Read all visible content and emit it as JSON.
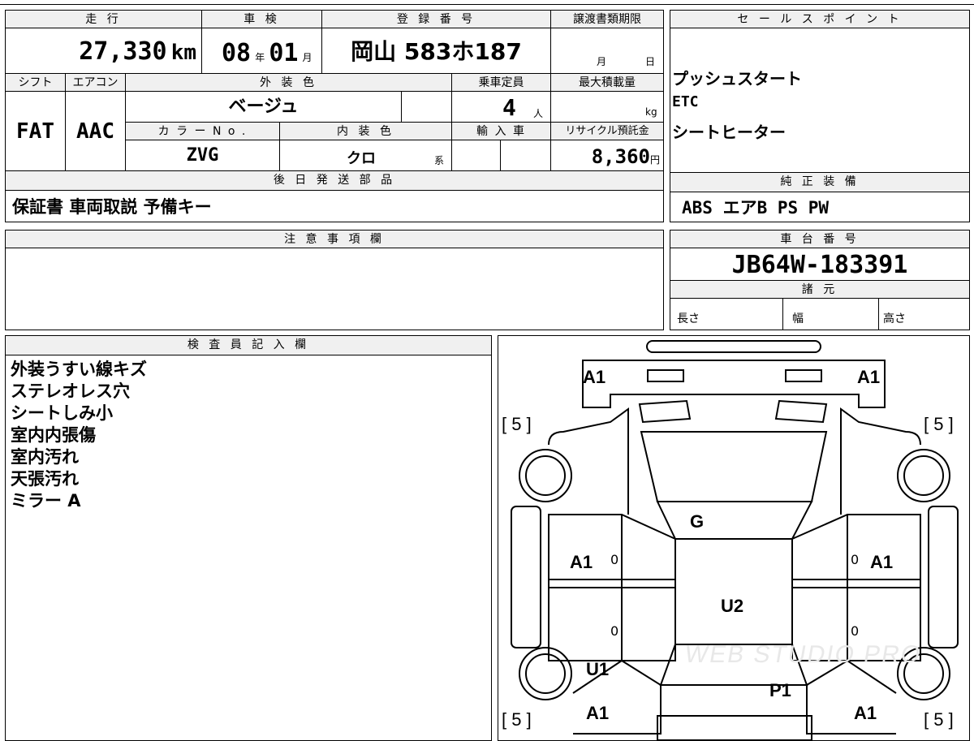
{
  "top_section": {
    "headers": {
      "mileage": "走 行",
      "inspection": "車 検",
      "registration": "登 録 番 号",
      "transfer_deadline": "譲渡書類期限",
      "shift": "シフト",
      "aircon": "エアコン",
      "exterior_color": "外 装 色",
      "capacity": "乗車定員",
      "max_load": "最大積載量",
      "color_no": "カ ラ ー N o .",
      "interior_color": "内 装 色",
      "import": "輸 入 車",
      "recycle_fee": "リサイクル預託金",
      "later_parts": "後 日 発 送 部 品"
    },
    "mileage_value": "27,330",
    "mileage_unit": "km",
    "inspection_year": "08",
    "inspection_year_unit": "年",
    "inspection_month": "01",
    "inspection_month_unit": "月",
    "registration_number": "岡山 583ホ187",
    "transfer_month_unit": "月",
    "transfer_day_unit": "日",
    "shift_value": "FAT",
    "aircon_value": "AAC",
    "exterior_color_value": "ベージュ",
    "capacity_value": "4",
    "capacity_unit": "人",
    "max_load_unit": "kg",
    "color_no_value": "ZVG",
    "interior_color_value": "クロ",
    "interior_color_suffix": "系",
    "recycle_fee_value": "8,360",
    "recycle_fee_unit": "円",
    "later_parts_value": "保証書 車両取説 予備キー"
  },
  "sales_points": {
    "header": "セ ー ル ス ポ イ ン ト",
    "items": [
      "プッシュスタート",
      "ETC",
      "シートヒーター"
    ]
  },
  "standard_equipment": {
    "header": "純 正 装 備",
    "value": "ABS エアB PS PW"
  },
  "notes": {
    "header": "注 意 事 項 欄"
  },
  "chassis": {
    "header": "車 台 番 号",
    "value": "JB64W-183391"
  },
  "specs": {
    "header": "諸 元",
    "length": "長さ",
    "width": "幅",
    "height": "高さ"
  },
  "inspector": {
    "header": "検 査 員 記 入 欄",
    "lines": [
      "外装うすい線キズ",
      "ステレオレス穴",
      "シートしみ小",
      "室内内張傷",
      "室内汚れ",
      "天張汚れ",
      "ミラー A"
    ]
  },
  "diagram": {
    "labels": {
      "front_left": "A1",
      "front_right": "A1",
      "tire_fl": "[ 5 ]",
      "tire_fr": "[ 5 ]",
      "windshield": "G",
      "door_left": "A1",
      "door_right": "A1",
      "roof": "U2",
      "rear_left": "U1",
      "rear_center": "P1",
      "rear_left_bottom": "A1",
      "rear_right_bottom": "A1",
      "tire_rl": "[ 5 ]",
      "tire_rr": "[ 5 ]",
      "zero_1": "0",
      "zero_2": "0",
      "zero_3": "0",
      "zero_4": "0"
    },
    "watermark": "WEB STUDIO PRO"
  }
}
